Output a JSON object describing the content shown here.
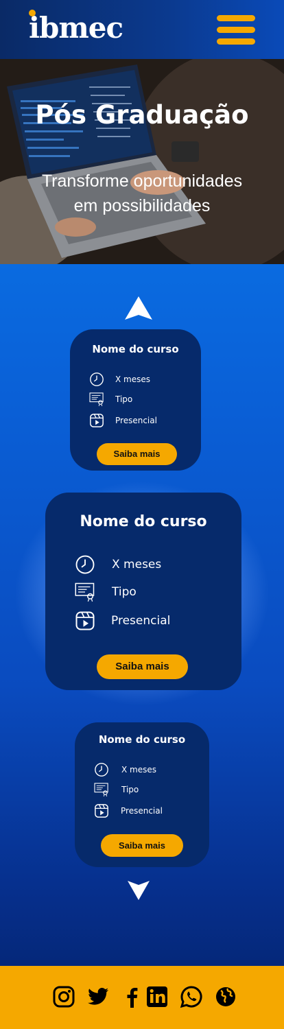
{
  "header": {
    "logo_text": "ibmec",
    "menu_icon": "hamburger-menu-icon",
    "brand_color": "#f5a800"
  },
  "hero": {
    "title": "Pós Graduação",
    "subtitle": "Transforme oportunidades em possibilidades"
  },
  "carousel": {
    "cards": [
      {
        "title": "Nome do curso",
        "duration": "X meses",
        "type": "Tipo",
        "mode": "Presencial",
        "button": "Saiba mais"
      },
      {
        "title": "Nome do curso",
        "duration": "X meses",
        "type": "Tipo",
        "mode": "Presencial",
        "button": "Saiba mais"
      },
      {
        "title": "Nome do curso",
        "duration": "X meses",
        "type": "Tipo",
        "mode": "Presencial",
        "button": "Saiba mais"
      }
    ]
  },
  "footer": {
    "social": [
      "instagram-icon",
      "twitter-icon",
      "facebook-icon",
      "linkedin-icon",
      "whatsapp-icon",
      "globe-icon"
    ]
  }
}
